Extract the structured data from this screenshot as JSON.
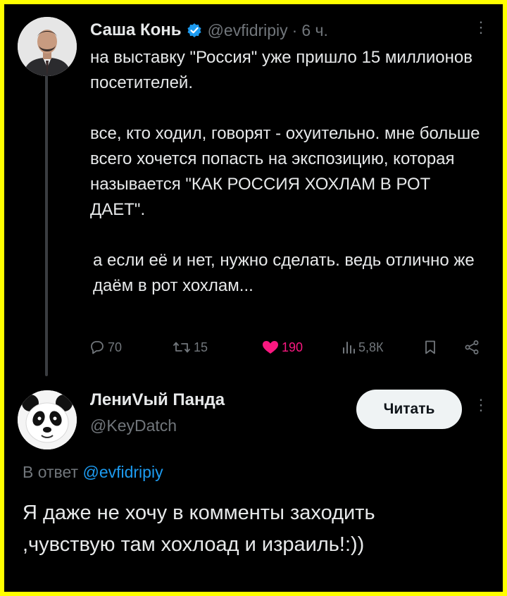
{
  "tweet": {
    "author_name": "Саша Конь",
    "handle": "@evfidripiy",
    "separator": "·",
    "time": "6 ч.",
    "paragraphs": [
      "на выставку \"Россия\" уже пришло 15 миллионов посетителей.",
      "все, кто ходил, говорят - охуительно. мне больше всего хочется попасть на экспозицию, которая называется \"КАК РОССИЯ ХОХЛАМ В РОТ ДАЕТ\".",
      "а если её и нет, нужно сделать. ведь отлично же даём в рот хохлам..."
    ],
    "actions": {
      "replies": "70",
      "reposts": "15",
      "likes": "190",
      "views": "5,8К"
    }
  },
  "reply": {
    "author_name": "ЛениVый Панда",
    "handle": "@KeyDatch",
    "follow_label": "Читать",
    "reply_prefix": "В ответ",
    "reply_mention": "@evfidripiy",
    "text": "Я даже не хочу в комменты заходить ,чувствую там хохлоад и израиль!:))"
  },
  "icons": {
    "verified": "verified-badge-icon",
    "more": "more-icon",
    "reply": "reply-icon",
    "repost": "repost-icon",
    "like": "heart-icon",
    "views": "views-icon",
    "bookmark": "bookmark-icon",
    "share": "share-icon"
  },
  "colors": {
    "frame_border": "#ffff00",
    "background": "#000000",
    "text": "#e7e9ea",
    "muted": "#71767b",
    "like": "#f91880",
    "link": "#1d9bf0",
    "verified": "#1d9bf0"
  }
}
